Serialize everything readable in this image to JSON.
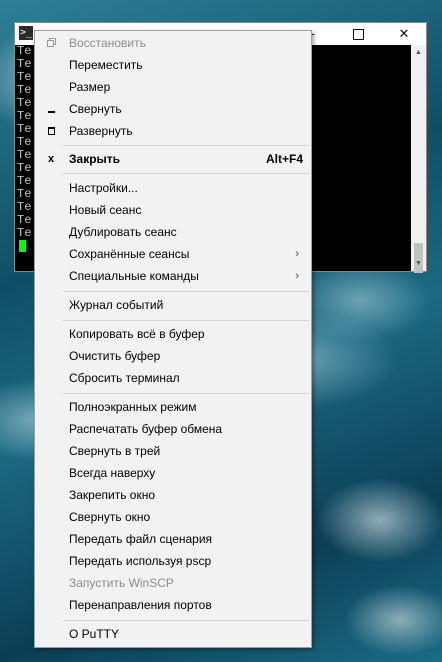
{
  "window": {
    "icon_glyph": ">_",
    "minimize_glyph": "—",
    "close_glyph": "✕"
  },
  "terminal": {
    "lines": [
      "Te",
      "Te",
      "Te",
      "Te",
      "Te",
      "Te",
      "Te",
      "Te",
      "Te",
      "Te",
      "Te",
      "Te",
      "Te",
      "Te",
      "Te"
    ]
  },
  "menu": {
    "restore": "Восстановить",
    "move": "Переместить",
    "size": "Размер",
    "minimize": "Свернуть",
    "maximize": "Развернуть",
    "close": "Закрыть",
    "close_shortcut": "Alt+F4",
    "close_icon_glyph": "x",
    "settings": "Настройки...",
    "new_session": "Новый сеанс",
    "duplicate_session": "Дублировать сеанс",
    "saved_sessions": "Сохранённые сеансы",
    "special_commands": "Специальные команды",
    "submenu_arrow": "›",
    "event_log": "Журнал событий",
    "copy_all": "Копировать всё в буфер",
    "clear_buffer": "Очистить буфер",
    "reset_terminal": "Сбросить терминал",
    "fullscreen": "Полноэкранных режим",
    "print_clipboard": "Распечатать буфер обмена",
    "minimize_tray": "Свернуть в трей",
    "always_on_top": "Всегда наверху",
    "pin_window": "Закрепить окно",
    "collapse_window": "Свернуть окно",
    "send_script": "Передать файл сценария",
    "send_pscp": "Передать используя pscp",
    "run_winscp": "Запустить WinSCP",
    "port_forwarding": "Перенаправления портов",
    "about": "О PuTTY"
  }
}
